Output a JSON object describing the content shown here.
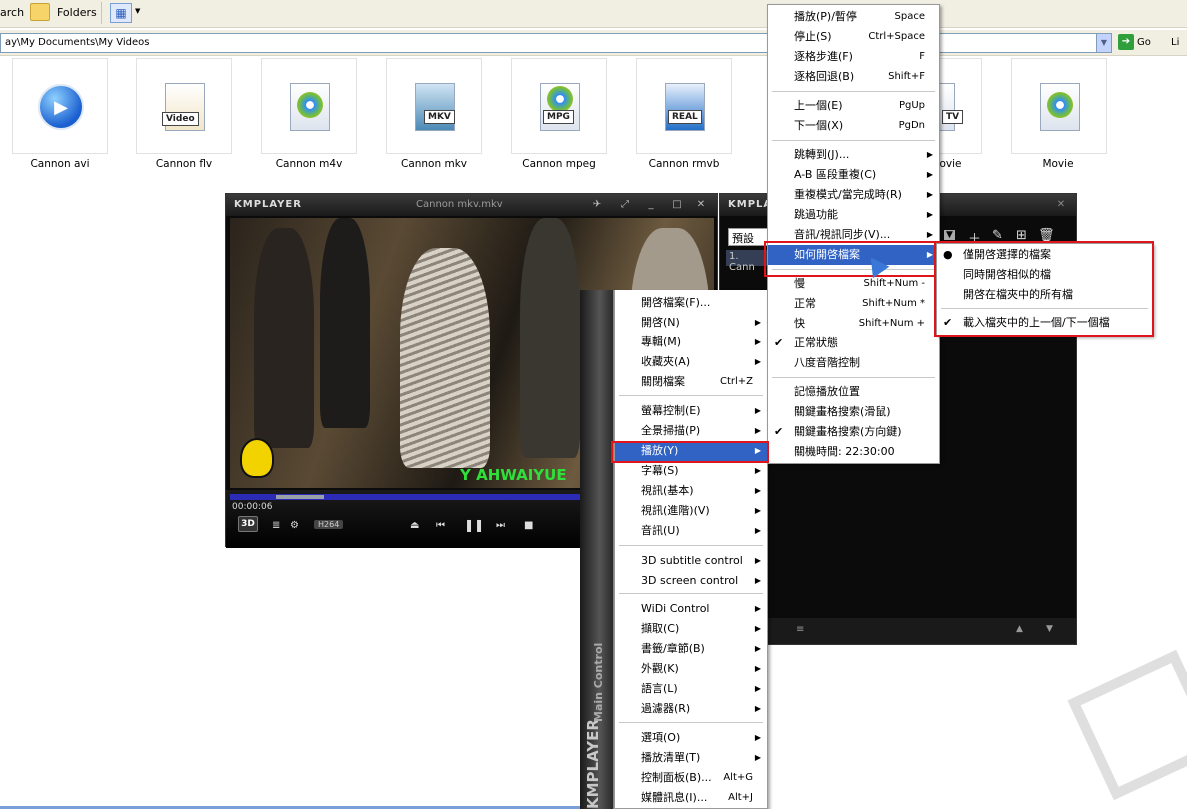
{
  "explorer": {
    "toolbar": {
      "search_label": "arch",
      "folders_label": "Folders"
    },
    "address": {
      "path": "ay\\My Documents\\My Videos",
      "go_label": "Go",
      "links_label": "Li"
    },
    "files": [
      {
        "label": "Cannon avi",
        "icon": "play-circle-icon"
      },
      {
        "label": "Cannon flv",
        "icon": "video-clapper-icon"
      },
      {
        "label": "Cannon m4v",
        "icon": "media-file-icon"
      },
      {
        "label": "Cannon mkv",
        "icon": "mkv-file-icon"
      },
      {
        "label": "Cannon mpeg",
        "icon": "mpg-file-icon"
      },
      {
        "label": "Cannon rmvb",
        "icon": "real-file-icon"
      },
      {
        "label": "lovie",
        "icon": "dtv-file-icon"
      },
      {
        "label": "Movie",
        "icon": "media-file-icon"
      }
    ]
  },
  "kmplayer": {
    "logo": "KMPLAYER",
    "file_title": "Cannon mkv.mkv",
    "time": "00:00:06",
    "btn_3d": "3D",
    "codec_badge": "H264",
    "watermark": "Y  AHWAIYUE",
    "progress_fraction": 0.2
  },
  "playlist": {
    "logo": "KMPLA",
    "preset_value": "預設",
    "first_item": "1. Cann"
  },
  "main_control": {
    "brand": "KMPLAYER",
    "caption": "Main Control"
  },
  "main_menu": [
    {
      "label": "開啓檔案(F)...",
      "key": "",
      "arrow": false
    },
    {
      "label": "開啓(N)",
      "key": "",
      "arrow": true
    },
    {
      "label": "專輯(M)",
      "key": "",
      "arrow": true
    },
    {
      "label": "收藏夾(A)",
      "key": "",
      "arrow": true
    },
    {
      "label": "關閉檔案",
      "key": "Ctrl+Z",
      "arrow": false
    },
    {
      "label": "螢幕控制(E)",
      "key": "",
      "arrow": true
    },
    {
      "label": "全景掃描(P)",
      "key": "",
      "arrow": true
    },
    {
      "label": "播放(Y)",
      "key": "",
      "arrow": true
    },
    {
      "label": "字幕(S)",
      "key": "",
      "arrow": true
    },
    {
      "label": "視訊(基本)",
      "key": "",
      "arrow": true
    },
    {
      "label": "視訊(進階)(V)",
      "key": "",
      "arrow": true
    },
    {
      "label": "音訊(U)",
      "key": "",
      "arrow": true
    },
    {
      "label": "3D subtitle control",
      "key": "",
      "arrow": true
    },
    {
      "label": "3D screen control",
      "key": "",
      "arrow": true
    },
    {
      "label": "WiDi Control",
      "key": "",
      "arrow": true
    },
    {
      "label": "擷取(C)",
      "key": "",
      "arrow": true
    },
    {
      "label": "書籤/章節(B)",
      "key": "",
      "arrow": true
    },
    {
      "label": "外觀(K)",
      "key": "",
      "arrow": true
    },
    {
      "label": "語言(L)",
      "key": "",
      "arrow": true
    },
    {
      "label": "過濾器(R)",
      "key": "",
      "arrow": true
    },
    {
      "label": "選項(O)",
      "key": "",
      "arrow": true
    },
    {
      "label": "播放清單(T)",
      "key": "",
      "arrow": true
    },
    {
      "label": "控制面板(B)...",
      "key": "Alt+G",
      "arrow": false
    },
    {
      "label": "媒體訊息(I)...",
      "key": "Alt+J",
      "arrow": false
    }
  ],
  "play_menu": [
    {
      "label": "播放(P)/暫停",
      "key": "Space",
      "arrow": false,
      "check": false
    },
    {
      "label": "停止(S)",
      "key": "Ctrl+Space",
      "arrow": false,
      "check": false
    },
    {
      "label": "逐格步進(F)",
      "key": "F",
      "arrow": false,
      "check": false
    },
    {
      "label": "逐格回退(B)",
      "key": "Shift+F",
      "arrow": false,
      "check": false
    },
    {
      "label": "上一個(E)",
      "key": "PgUp",
      "arrow": false,
      "check": false
    },
    {
      "label": "下一個(X)",
      "key": "PgDn",
      "arrow": false,
      "check": false
    },
    {
      "label": "跳轉到(J)...",
      "key": "",
      "arrow": true,
      "check": false
    },
    {
      "label": "A-B 區段重複(C)",
      "key": "",
      "arrow": true,
      "check": false
    },
    {
      "label": "重複模式/當完成時(R)",
      "key": "",
      "arrow": true,
      "check": false
    },
    {
      "label": "跳過功能",
      "key": "",
      "arrow": true,
      "check": false
    },
    {
      "label": "音訊/視訊同步(V)...",
      "key": "",
      "arrow": true,
      "check": false
    },
    {
      "label": "如何開啓檔案",
      "key": "",
      "arrow": true,
      "check": false
    },
    {
      "label": "慢",
      "key": "Shift+Num -",
      "arrow": false,
      "check": false
    },
    {
      "label": "正常",
      "key": "Shift+Num *",
      "arrow": false,
      "check": false
    },
    {
      "label": "快",
      "key": "Shift+Num +",
      "arrow": false,
      "check": false
    },
    {
      "label": "正常狀態",
      "key": "",
      "arrow": false,
      "check": true
    },
    {
      "label": "八度音階控制",
      "key": "",
      "arrow": false,
      "check": false
    },
    {
      "label": "記憶播放位置",
      "key": "",
      "arrow": false,
      "check": false
    },
    {
      "label": "關鍵畫格搜索(滑鼠)",
      "key": "",
      "arrow": false,
      "check": false
    },
    {
      "label": "關鍵畫格搜索(方向鍵)",
      "key": "",
      "arrow": false,
      "check": true
    },
    {
      "label": "關機時間: 22:30:00",
      "key": "",
      "arrow": false,
      "check": false
    }
  ],
  "open_submenu": [
    {
      "label": "僅開啓選擇的檔案",
      "mark": "●"
    },
    {
      "label": "同時開啓相似的檔",
      "mark": ""
    },
    {
      "label": "開啓在檔夾中的所有檔",
      "mark": ""
    },
    {
      "label": "載入檔夾中的上一個/下一個檔",
      "mark": "✔"
    }
  ]
}
